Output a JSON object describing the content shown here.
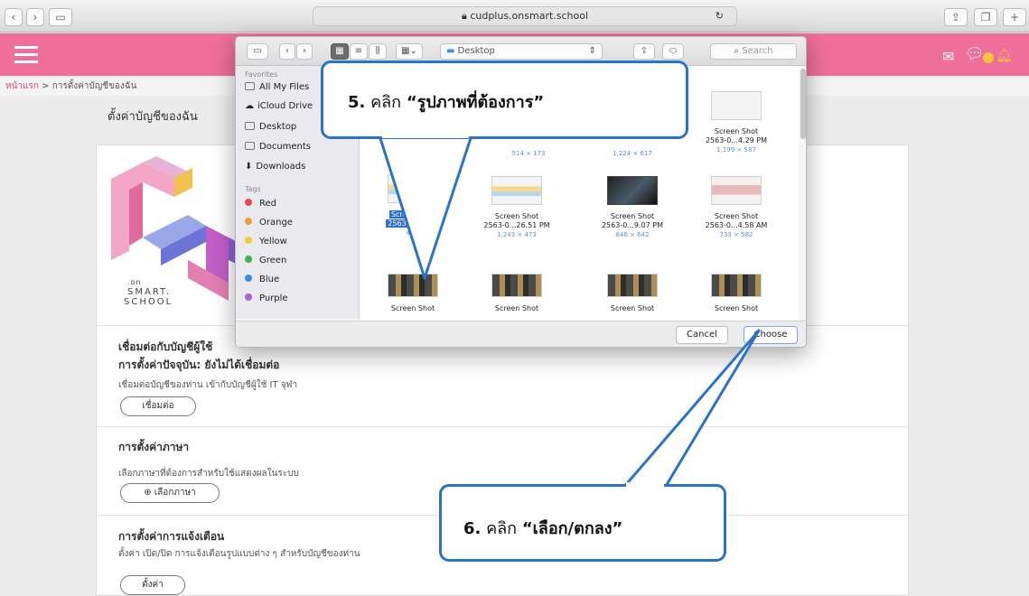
{
  "browser": {
    "url": "cudplus.onsmart.school"
  },
  "breadcrumb": {
    "home": "หน้าแรก",
    "sep": ">",
    "current": "การตั้งค่าบัญชีของฉัน"
  },
  "page": {
    "title": "ตั้งค่าบัญชีของฉัน"
  },
  "logo": {
    "line1": ".on",
    "line2": "SMART.",
    "line3": "SCHOOL"
  },
  "sections": {
    "connect": {
      "title": "เชื่อมต่อกับบัญชีผู้ใช้",
      "status": "การตั้งค่าปัจจุบัน: ยังไม่ได้เชื่อมต่อ",
      "desc": "เชื่อมต่อบัญชีของท่าน เข้ากับบัญชีผู้ใช้ IT จุฬา",
      "button": "เชื่อมต่อ"
    },
    "language": {
      "title": "การตั้งค่าภาษา",
      "desc": "เลือกภาษาที่ต้องการสำหรับใช้แสดงผลในระบบ",
      "button": "เลือกภาษา"
    },
    "notify": {
      "title": "การตั้งค่าการแจ้งเตือน",
      "desc": "ตั้งค่า เปิด/ปิด การแจ้งเตือนรูปแบบต่าง ๆ สำหรับบัญชีของท่าน",
      "button": "ตั้งค่า"
    }
  },
  "dialog": {
    "folder": "Desktop",
    "search_placeholder": "Search",
    "sidebar": {
      "favorites_label": "Favorites",
      "favorites": [
        "All My Files",
        "iCloud Drive",
        "Desktop",
        "Documents",
        "Downloads"
      ],
      "tags_label": "Tags",
      "tags": [
        {
          "name": "Red",
          "color": "#e5484d"
        },
        {
          "name": "Orange",
          "color": "#f39c34"
        },
        {
          "name": "Yellow",
          "color": "#f3cf2f"
        },
        {
          "name": "Green",
          "color": "#3cb54a"
        },
        {
          "name": "Blue",
          "color": "#3a8ee6"
        },
        {
          "name": "Purple",
          "color": "#b05ed6"
        }
      ]
    },
    "files": [
      {
        "name": "",
        "dims": "514 × 173"
      },
      {
        "name": "",
        "dims": "1,224 × 617"
      },
      {
        "name": "Screen Shot 2563-0...4.29 PM",
        "line1": "Screen Shot",
        "line2": "2563-0...4.29 PM",
        "dims": "1,199 × 587"
      },
      {
        "name": "Screen Shot 2563-0...1 PM",
        "line1": "Screen Shot",
        "line2": "2563-0...1 PM",
        "dims": "46..."
      },
      {
        "name": "Screen Shot 2563-0...26.51 PM",
        "line1": "Screen Shot",
        "line2": "2563-0...26.51 PM",
        "dims": "1,243 × 473"
      },
      {
        "name": "Screen Shot 2563-0...9.07 PM",
        "line1": "Screen Shot",
        "line2": "2563-0...9.07 PM",
        "dims": "846 × 642"
      },
      {
        "name": "Screen Shot 2563-0...4.58 AM",
        "line1": "Screen Shot",
        "line2": "2563-0...4.58 AM",
        "dims": "733 × 582"
      },
      {
        "name": "Screen Shot",
        "line1": "Screen Shot"
      },
      {
        "name": "Screen Shot",
        "line1": "Screen Shot"
      },
      {
        "name": "Screen Shot",
        "line1": "Screen Shot"
      },
      {
        "name": "Screen Shot",
        "line1": "Screen Shot"
      }
    ],
    "cancel": "Cancel",
    "choose": "Choose"
  },
  "callouts": {
    "step5": {
      "num": "5.",
      "verb": "คลิก",
      "quote": "“รูปภาพที่ต้องการ”"
    },
    "step6": {
      "num": "6.",
      "verb": "คลิก",
      "quote": "“เลือก/ตกลง”"
    }
  },
  "colors": {
    "header": "#ef6f9a",
    "callout_border": "#2b73c9",
    "selection": "#2e6fd6"
  }
}
